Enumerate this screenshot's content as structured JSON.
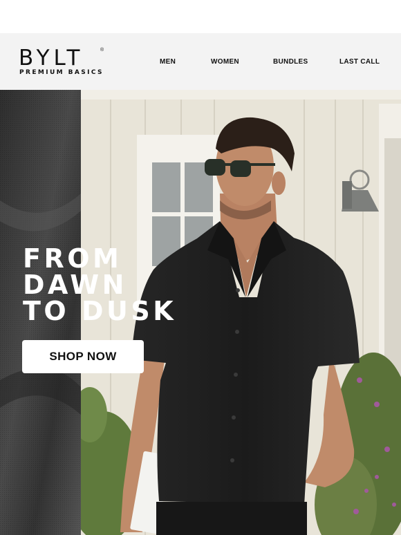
{
  "brand": {
    "name": "BYLT",
    "registered_mark": "®",
    "tagline": "PREMIUM BASICS"
  },
  "nav": {
    "items": [
      {
        "label": "MEN"
      },
      {
        "label": "WOMEN"
      },
      {
        "label": "BUNDLES"
      },
      {
        "label": "LAST CALL"
      }
    ]
  },
  "hero": {
    "headline": [
      "FROM",
      "DAWN",
      "TO DUSK"
    ],
    "cta_label": "SHOP NOW"
  },
  "colors": {
    "header_bg": "#f3f3f3",
    "fabric_panel": "#3b3b3b",
    "siding": "#e8e4d8",
    "shirt": "#1f1f1f",
    "skin": "#c08b6a",
    "foliage": "#5f7a3c",
    "flowers": "#a05a9a",
    "cta_bg": "#ffffff",
    "headline_text": "#ffffff"
  },
  "icons": {
    "wall_lamp": "wall-lamp-icon",
    "sunglasses": "sunglasses-icon"
  }
}
